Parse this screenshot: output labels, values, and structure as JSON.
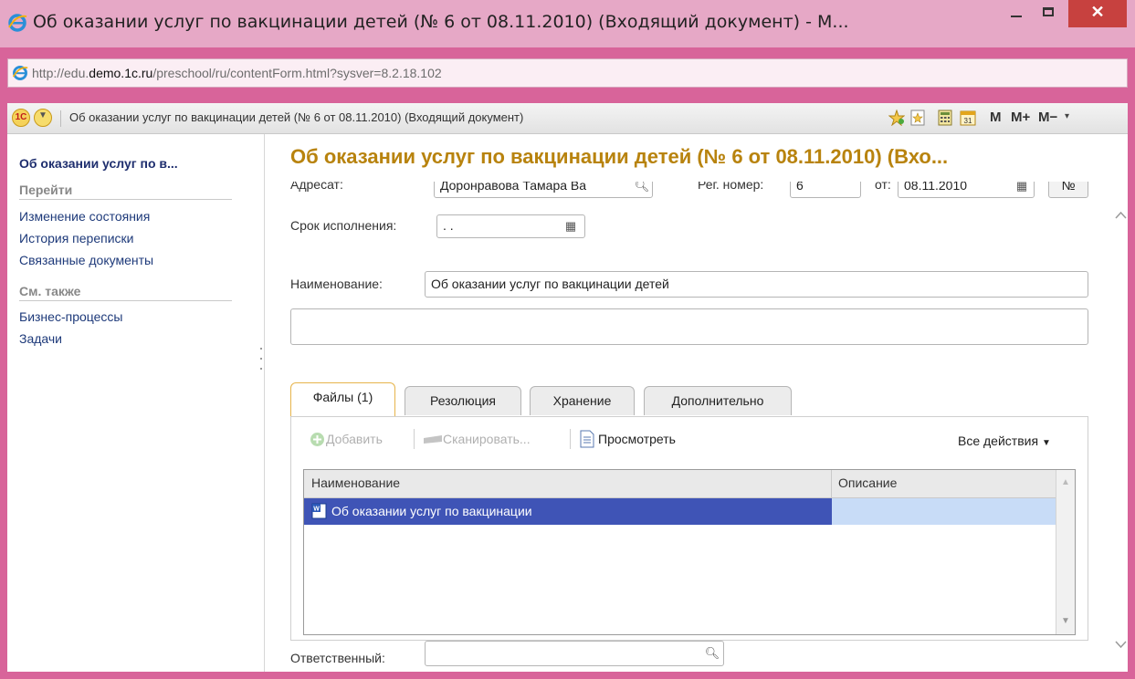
{
  "window": {
    "title": "Об оказании услуг по вакцинации детей (№ 6 от 08.11.2010) (Входящий документ) - М...",
    "minimize_glyph": "−",
    "close_glyph": "✕"
  },
  "address": {
    "prefix": "http://edu.",
    "domain": "demo.1c.ru",
    "path": "/preschool/ru/contentForm.html?sysver=8.2.18.102"
  },
  "toolbar": {
    "logo_text": "1С",
    "doc_title": "Об оказании услуг по вакцинации детей (№ 6 от 08.11.2010) (Входящий документ)",
    "m_label": "M",
    "mplus_label": "M+",
    "mminus_label": "M−",
    "calendar_day": "31"
  },
  "sidebar": {
    "title": "Об оказании услуг по в...",
    "goto_header": "Перейти",
    "goto_items": [
      "Изменение состояния",
      "История переписки",
      "Связанные документы"
    ],
    "see_also_header": "См. также",
    "see_also_items": [
      "Бизнес-процессы",
      "Задачи"
    ]
  },
  "form": {
    "title": "Об оказании услуг по вакцинации детей (№ 6 от 08.11.2010) (Вхо...",
    "addressee_label": "Адресат:",
    "addressee_value": "Доронравова Тамара Ва",
    "reg_number_label": "Рег. номер:",
    "reg_number_value": "6",
    "date_from_label": "от:",
    "date_from_value": "08.11.2010",
    "number_button": "№",
    "due_label": "Срок исполнения:",
    "due_value": ". .",
    "name_label": "Наименование:",
    "name_value": "Об оказании услуг по вакцинации детей",
    "description_value": "",
    "responsible_label": "Ответственный:",
    "responsible_value": ""
  },
  "tabs": [
    {
      "label": "Файлы (1)",
      "active": true
    },
    {
      "label": "Резолюция",
      "active": false
    },
    {
      "label": "Хранение",
      "active": false
    },
    {
      "label": "Дополнительно",
      "active": false
    }
  ],
  "files_panel": {
    "add_label": "Добавить",
    "scan_label": "Сканировать...",
    "view_label": "Просмотреть",
    "all_actions_label": "Все действия",
    "columns": [
      "Наименование",
      "Описание"
    ],
    "rows": [
      {
        "name": "Об оказании услуг по вакцинации",
        "description": ""
      }
    ]
  },
  "colors": {
    "window_frame": "#d8649a",
    "title_accent": "#b8830e",
    "selected_row": "#3f54b6",
    "link": "#1e3a7a"
  }
}
